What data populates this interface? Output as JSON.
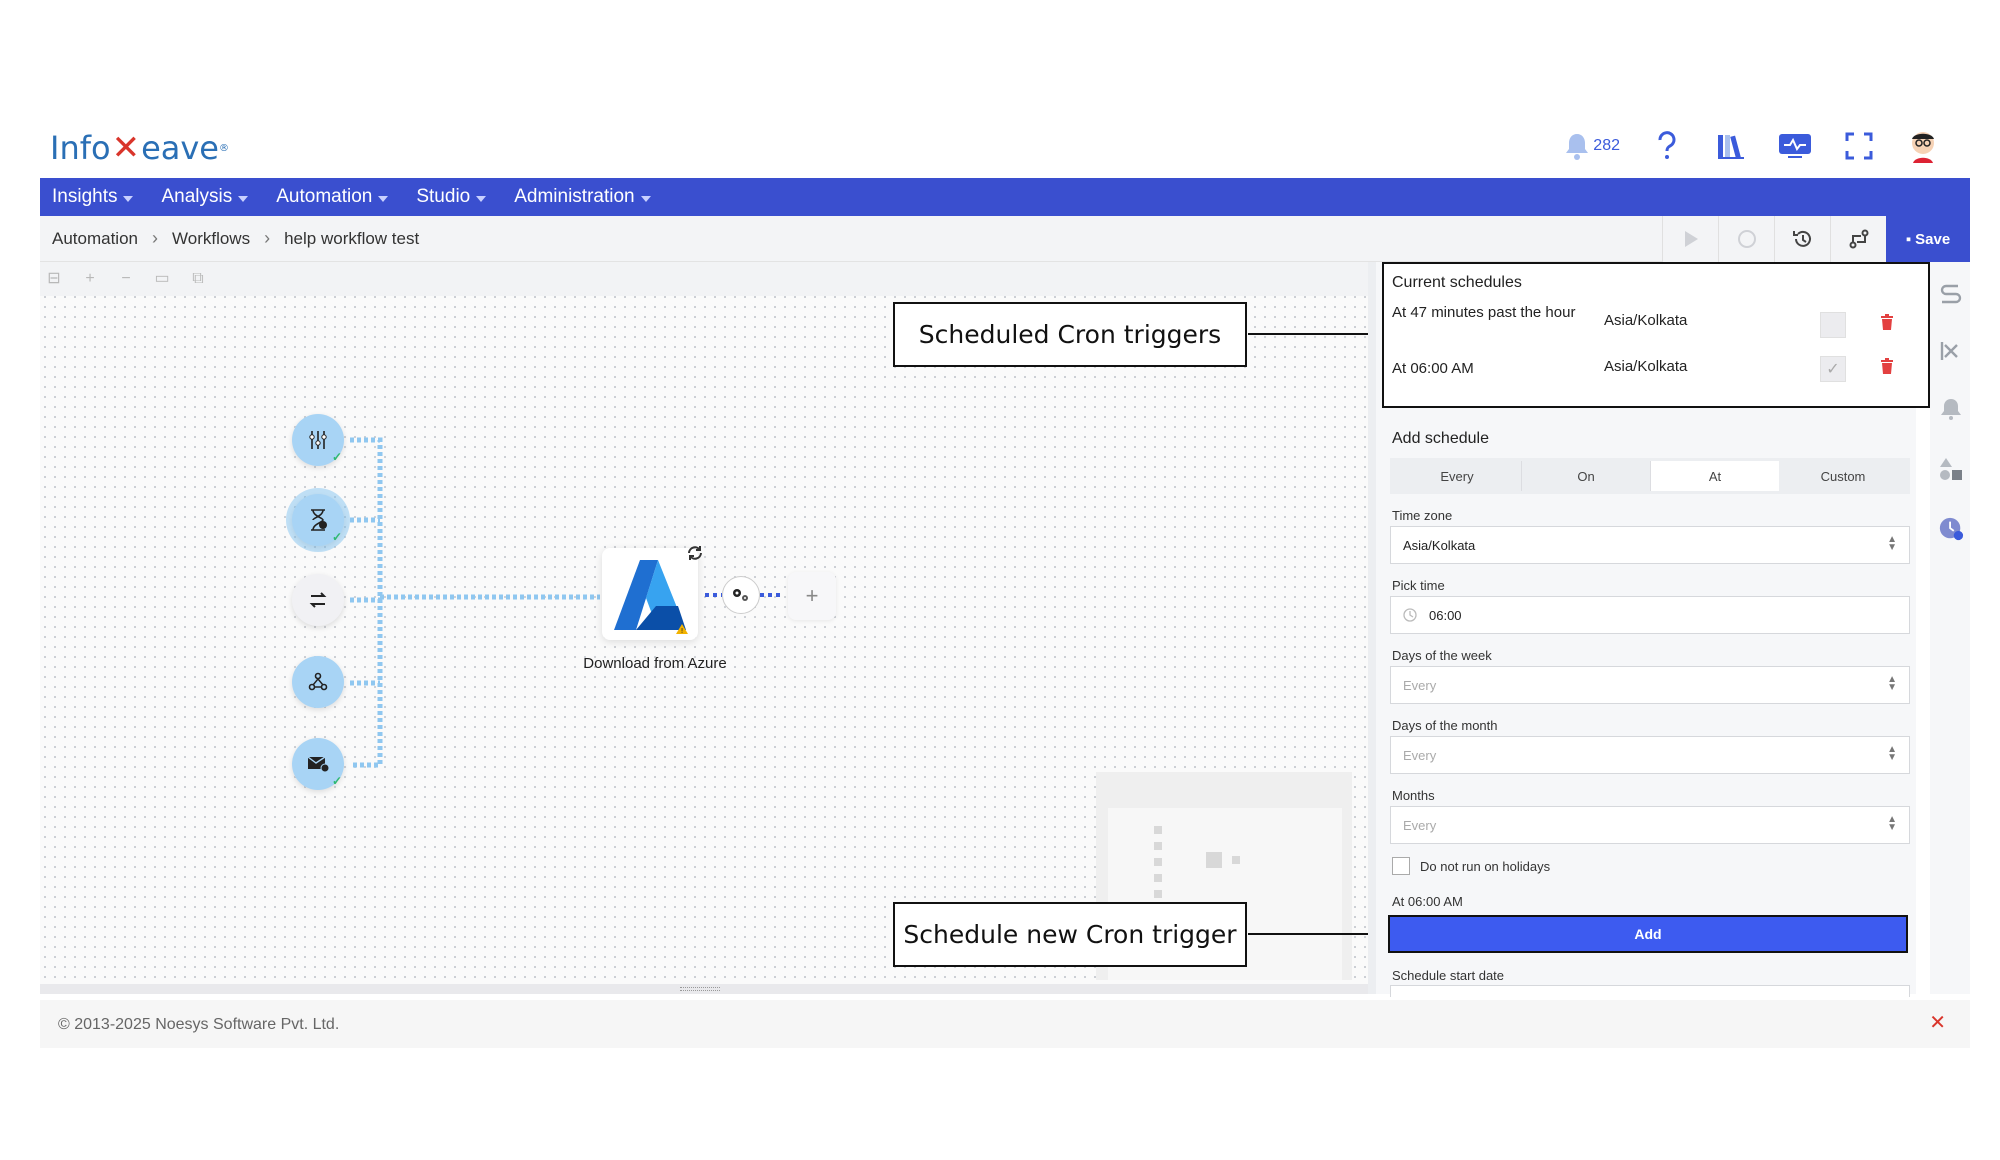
{
  "header": {
    "logo_left": "Info",
    "logo_right": "eave",
    "notification_count": "282"
  },
  "nav": {
    "items": [
      {
        "label": "Insights"
      },
      {
        "label": "Analysis"
      },
      {
        "label": "Automation"
      },
      {
        "label": "Studio"
      },
      {
        "label": "Administration"
      }
    ]
  },
  "breadcrumb": [
    "Automation",
    "Workflows",
    "help workflow test"
  ],
  "toolbar": {
    "save_label": "Save"
  },
  "canvas": {
    "azure_node_label": "Download from Azure",
    "plus_label": "+"
  },
  "callouts": {
    "scheduled": "Scheduled Cron triggers",
    "new": "Schedule new Cron trigger"
  },
  "panel": {
    "current_title": "Current schedules",
    "schedules": [
      {
        "desc": "At 47 minutes past the hour",
        "tz": "Asia/Kolkata",
        "enabled": false
      },
      {
        "desc": "At 06:00 AM",
        "tz": "Asia/Kolkata",
        "enabled": true
      }
    ],
    "add_title": "Add schedule",
    "tabs": [
      "Every",
      "On",
      "At",
      "Custom"
    ],
    "active_tab": "At",
    "timezone_label": "Time zone",
    "timezone_value": "Asia/Kolkata",
    "pick_time_label": "Pick time",
    "pick_time_value": "06:00",
    "days_week_label": "Days of the week",
    "days_week_placeholder": "Every",
    "days_month_label": "Days of the month",
    "days_month_placeholder": "Every",
    "months_label": "Months",
    "months_placeholder": "Every",
    "holidays_label": "Do not run on holidays",
    "summary": "At 06:00 AM",
    "add_button": "Add",
    "start_date_label": "Schedule start date"
  },
  "footer": {
    "copyright": "© 2013-2025 Noesys Software Pvt. Ltd."
  },
  "colors": {
    "brand": "#3a4fcf",
    "add_button": "#3d5bf0",
    "node": "#a8d4f5",
    "danger": "#e34040"
  }
}
